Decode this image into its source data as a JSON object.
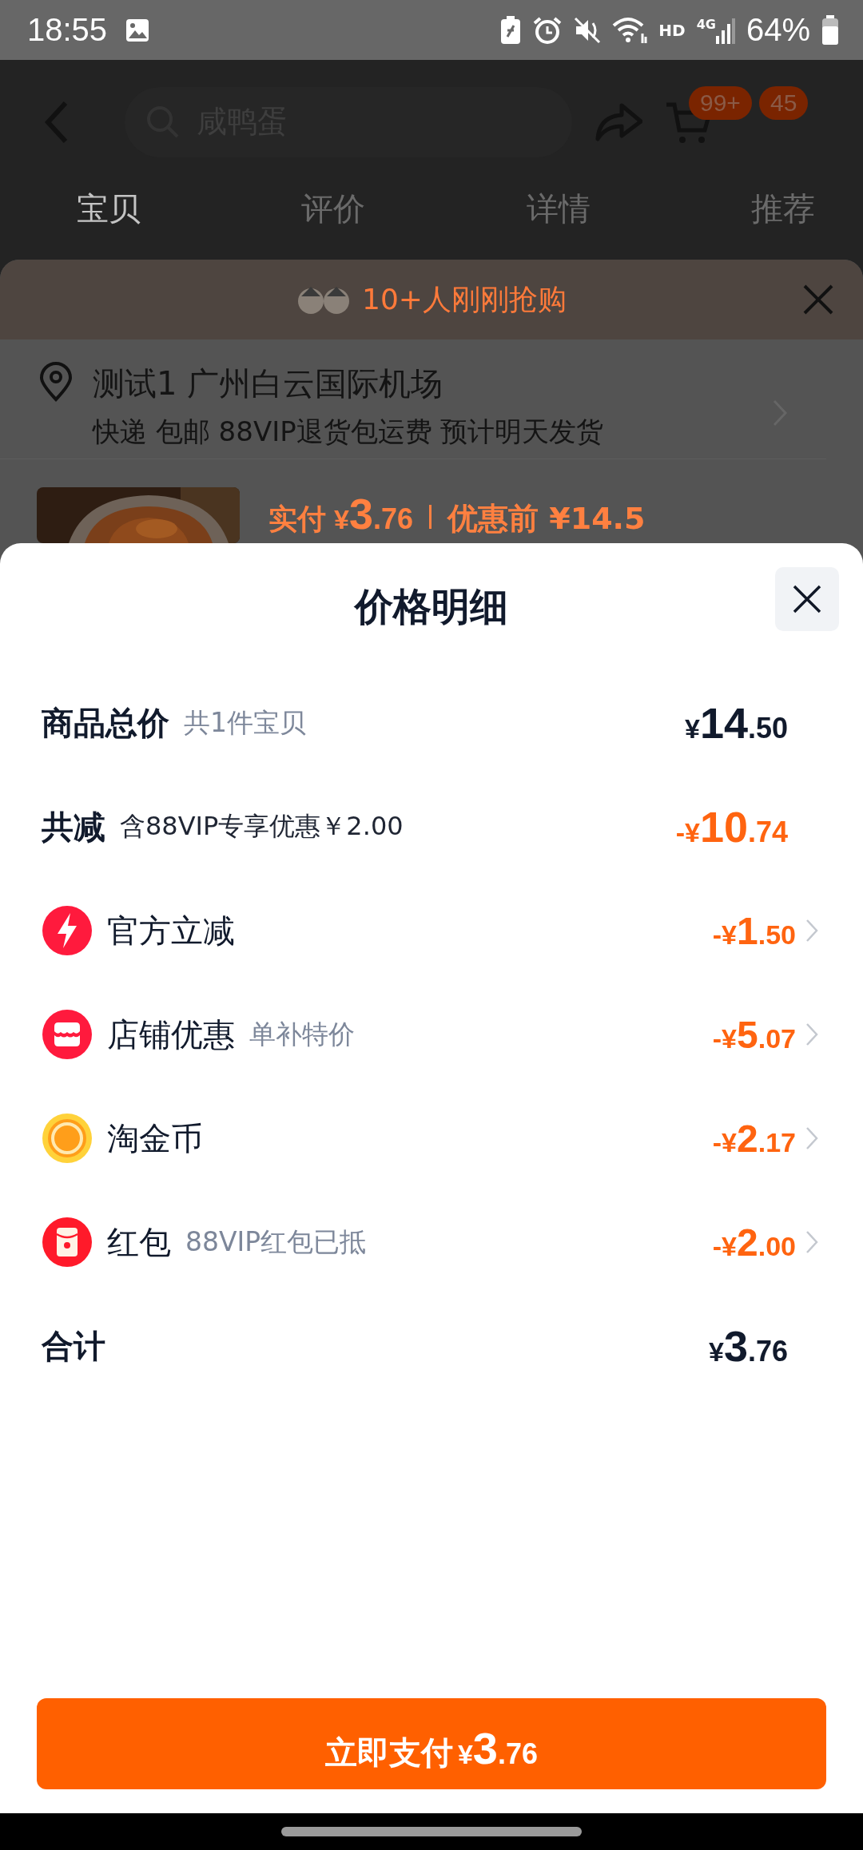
{
  "status_bar": {
    "time": "18:55",
    "hd": "HD",
    "network": "4G",
    "battery": "64%"
  },
  "top_bar": {
    "search": {
      "placeholder": "咸鸭蛋"
    },
    "cart_badge": "99+",
    "message_badge": "45"
  },
  "tabs": [
    {
      "label": "宝贝",
      "selected": true
    },
    {
      "label": "评价",
      "selected": false
    },
    {
      "label": "详情",
      "selected": false
    },
    {
      "label": "推荐",
      "selected": false
    }
  ],
  "banner": {
    "text": "10+人刚刚抢购"
  },
  "address": {
    "name": "测试1 广州白云国际机场",
    "delivery": "快递 包邮 88VIP退货包运费 预计明天发货"
  },
  "product": {
    "paid_label": "实付",
    "paid": {
      "currency": "¥",
      "integer": "3",
      "decimal": ".76"
    },
    "before": "优惠前 ¥14.5"
  },
  "sheet": {
    "title": "价格明细",
    "rows": [
      {
        "kind": "header",
        "label": "商品总价",
        "note": "共1件宝贝",
        "amount": {
          "currency": "¥",
          "integer": "14",
          "decimal": ".50"
        }
      },
      {
        "kind": "discount",
        "label": "共减",
        "note": "含88VIP专享优惠￥2.00",
        "amount": {
          "currency": "-¥",
          "integer": "10",
          "decimal": ".74"
        }
      },
      {
        "kind": "official",
        "label": "官方立减",
        "amount": {
          "currency": "-¥",
          "integer": "1",
          "decimal": ".50"
        }
      },
      {
        "kind": "shop",
        "label": "店铺优惠",
        "note": "单补特价",
        "amount": {
          "currency": "-¥",
          "integer": "5",
          "decimal": ".07"
        }
      },
      {
        "kind": "coins",
        "label": "淘金币",
        "amount": {
          "currency": "-¥",
          "integer": "2",
          "decimal": ".17"
        }
      },
      {
        "kind": "packet",
        "label": "红包",
        "note": "88VIP红包已抵",
        "amount": {
          "currency": "-¥",
          "integer": "2",
          "decimal": ".00"
        }
      },
      {
        "kind": "header",
        "label": "合计",
        "amount": {
          "currency": "¥",
          "integer": "3",
          "decimal": ".76"
        }
      }
    ],
    "pay_button": {
      "label": "立即支付",
      "amount": {
        "currency": "¥",
        "integer": "3",
        "decimal": ".76"
      }
    }
  }
}
